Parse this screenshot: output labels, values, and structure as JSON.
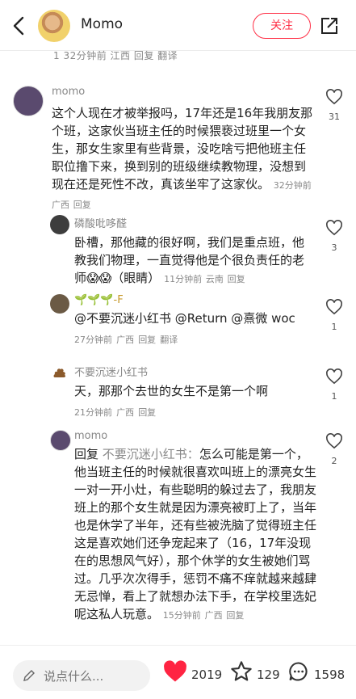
{
  "header": {
    "author": "Momo",
    "follow_label": "关注"
  },
  "prev_meta": "1 32分钟前 江西 回复 翻译",
  "comments": [
    {
      "name": "momo",
      "text": "这个人现在才被举报吗，17年还是16年我朋友那个班，这家伙当班主任的时候猥亵过班里一个女生，那女生家里有些背景，没吃啥亏把他班主任职位撸下来，换到别的班级继续教物理，没想到现在还是死性不改，真该坐牢了这家伙。",
      "time": "32分钟前",
      "region": "广西",
      "reply": "回复",
      "likes": "31"
    },
    {
      "name": "磷酸吡哆醛",
      "text": "卧槽，那他藏的很好啊，我们是重点班，他教我们物理，一直觉得他是个很负责任的老师",
      "emoji": "😱😱",
      "tag": "（眼睛）",
      "time": "11分钟前",
      "region": "云南",
      "reply": "回复",
      "likes": "3"
    },
    {
      "name": "🌱🌱🌱-F",
      "text": "@不要沉迷小红书 @Return @熹微 woc",
      "time": "27分钟前",
      "region": "广西",
      "reply": "回复",
      "translate": "翻译",
      "likes": "1"
    },
    {
      "name": "不要沉迷小红书",
      "text": "天，那那个去世的女生不是第一个啊",
      "time": "21分钟前",
      "region": "广西",
      "reply": "回复",
      "likes": "1"
    },
    {
      "name": "momo",
      "reply_prefix": "回复",
      "reply_to": "不要沉迷小红书：",
      "text": "怎么可能是第一个，他当班主任的时候就很喜欢叫班上的漂亮女生一对一开小灶，有些聪明的躲过去了，我朋友班上的那个女生就是因为漂亮被盯上了，当年也是休学了半年，还有些被洗脑了觉得班主任这是喜欢她们还争宠起来了（16，17年没现在的思想风气好），那个休学的女生被她们骂过。几乎次次得手，惩罚不痛不痒就越来越肆无忌惮，看上了就想办法下手，在学校里选妃呢这私人玩意。",
      "time": "15分钟前",
      "region": "广西",
      "reply": "回复",
      "likes": "2"
    }
  ],
  "bottom": {
    "placeholder": "说点什么...",
    "like_count": "2019",
    "star_count": "129",
    "comment_count": "1598"
  },
  "colors": {
    "accent": "#ff2f46"
  }
}
